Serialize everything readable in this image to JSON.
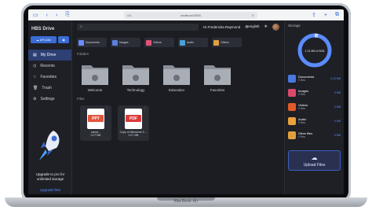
{
  "browser": {
    "url": "localhost:3000",
    "aa_label": "AA"
  },
  "app": {
    "logo": "HBS Drive"
  },
  "sidebar": {
    "upload_label": "UPLOAD",
    "items": [
      {
        "label": "My Drive",
        "icon": "drive-icon",
        "active": true
      },
      {
        "label": "Recents",
        "icon": "clock-icon"
      },
      {
        "label": "Favorites",
        "icon": "star-icon"
      },
      {
        "label": "Trash",
        "icon": "trash-icon"
      },
      {
        "label": "Settings",
        "icon": "gear-icon"
      }
    ],
    "promo_text": "Upgrade to pro for unlimited storage",
    "promo_link": "Upgrade files"
  },
  "topbar": {
    "greeting": "Hi Fredericka Raymond",
    "language": "english"
  },
  "categories": [
    {
      "label": "Documents",
      "color": "#6c8cff"
    },
    {
      "label": "Images",
      "color": "#5a7fe0"
    },
    {
      "label": "Videos",
      "color": "#e0527a"
    },
    {
      "label": "Audio",
      "color": "#4aa0d8"
    },
    {
      "label": "Others",
      "color": "#e0a040"
    }
  ],
  "folders_title": "Folders",
  "folders": [
    "Welcome",
    "Technology",
    "Education",
    "Favorites"
  ],
  "files_title": "Files",
  "files": [
    {
      "name": "sampl...",
      "type": "PPT",
      "size": "0.07 MB",
      "color": "#e5533c"
    },
    {
      "name": "Copy of Milestone 5 ...",
      "type": "PDF",
      "size": "0.07 MB",
      "color": "#d93b3b"
    }
  ],
  "storage": {
    "title": "Storage",
    "used_text": "1.13 MB of 5GB",
    "used_fraction": 0.02,
    "items": [
      {
        "label": "Documents",
        "count": "0 files",
        "value": "0.15 MB",
        "color": "#4a78e0"
      },
      {
        "label": "Images",
        "count": "0 files",
        "value": "0 MB",
        "color": "#d94a6a"
      },
      {
        "label": "Videos",
        "count": "0 files",
        "value": "0 MB",
        "color": "#e05a2a"
      },
      {
        "label": "Audio",
        "count": "0 files",
        "value": "0 MB",
        "color": "#e8a23a"
      },
      {
        "label": "Other files",
        "count": "0 files",
        "value": "0 MB",
        "color": "#e0a040"
      }
    ],
    "upload_label": "Upload Files"
  },
  "device_label": "MacBook Air"
}
